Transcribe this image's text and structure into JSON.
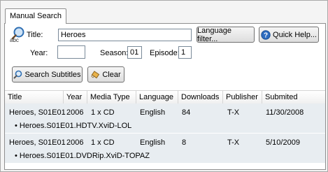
{
  "tab": {
    "label": "Manual Search"
  },
  "search": {
    "title_label": "Title:",
    "title_value": "Heroes",
    "year_label": "Year:",
    "year_value": "",
    "season_label": "Season:",
    "season_value": "01",
    "episode_label": "Episode:",
    "episode_value": "1",
    "abc_text": "abc"
  },
  "buttons": {
    "language_filter": "Language filter...",
    "quick_help": "Quick Help...",
    "search_subtitles": "Search Subtitles",
    "clear": "Clear"
  },
  "table": {
    "columns": [
      "Title",
      "Year",
      "Media Type",
      "Language",
      "Downloads",
      "Publisher",
      "Submited"
    ],
    "rows": [
      {
        "title": "Heroes, S01E01",
        "year": "2006",
        "media": "1 x CD",
        "language": "English",
        "downloads": "84",
        "publisher": "T-X",
        "submitted": "11/30/2008",
        "release": "• Heroes.S01E01.HDTV.XviD-LOL"
      },
      {
        "title": "Heroes, S01E01",
        "year": "2006",
        "media": "1 x CD",
        "language": "English",
        "downloads": "8",
        "publisher": "T-X",
        "submitted": "5/10/2009",
        "release": "• Heroes.S01E01.DVDRip.XviD-TOPAZ"
      }
    ]
  },
  "icons": {
    "search": "magnifier-icon",
    "help": "help-icon",
    "clear": "eraser-icon"
  }
}
